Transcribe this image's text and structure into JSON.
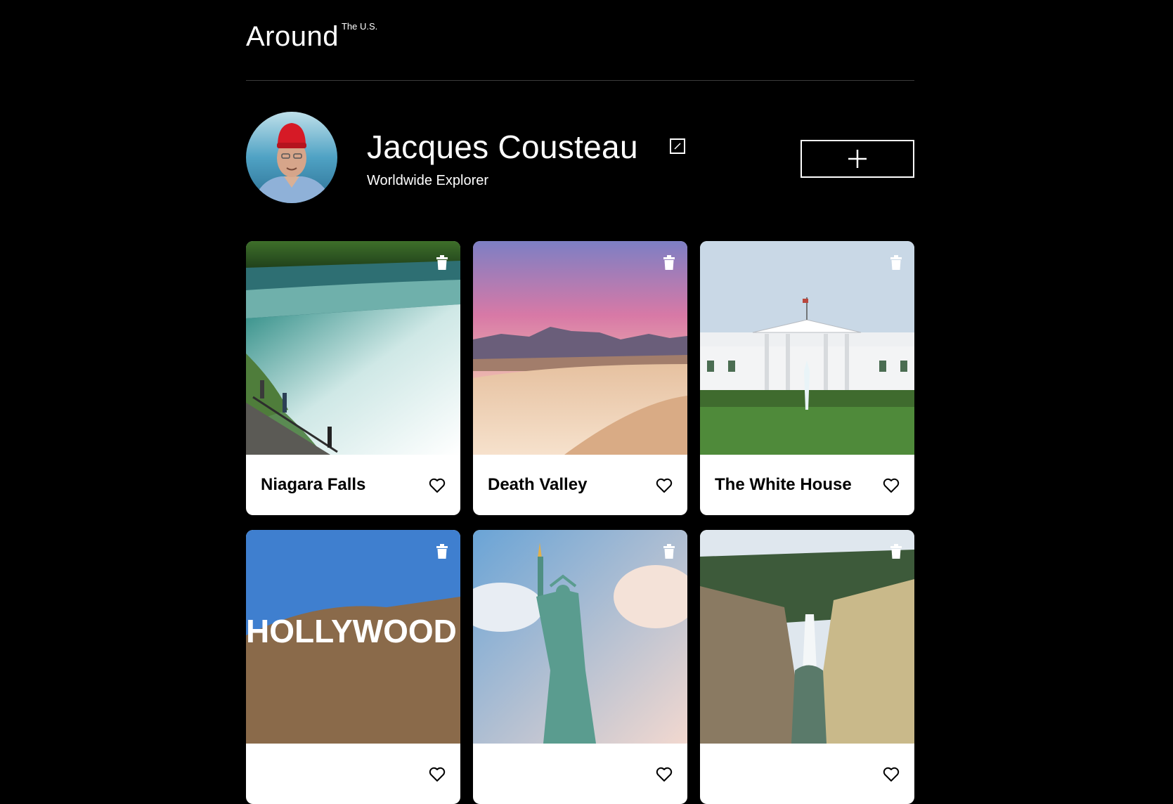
{
  "header": {
    "logo_main": "Around",
    "logo_sup": "The U.S."
  },
  "profile": {
    "name": "Jacques Cousteau",
    "about": "Worldwide Explorer"
  },
  "cards": [
    {
      "title": "Niagara Falls"
    },
    {
      "title": "Death Valley"
    },
    {
      "title": "The White House"
    },
    {
      "title": ""
    },
    {
      "title": ""
    },
    {
      "title": ""
    }
  ],
  "hollywood_sign_text": "HOLLYWOOD",
  "colors": {
    "background": "#000000",
    "text": "#ffffff",
    "card": "#ffffff",
    "card_text": "#000000"
  },
  "icons": [
    "edit-icon",
    "plus-icon",
    "trash-icon",
    "heart-icon"
  ]
}
